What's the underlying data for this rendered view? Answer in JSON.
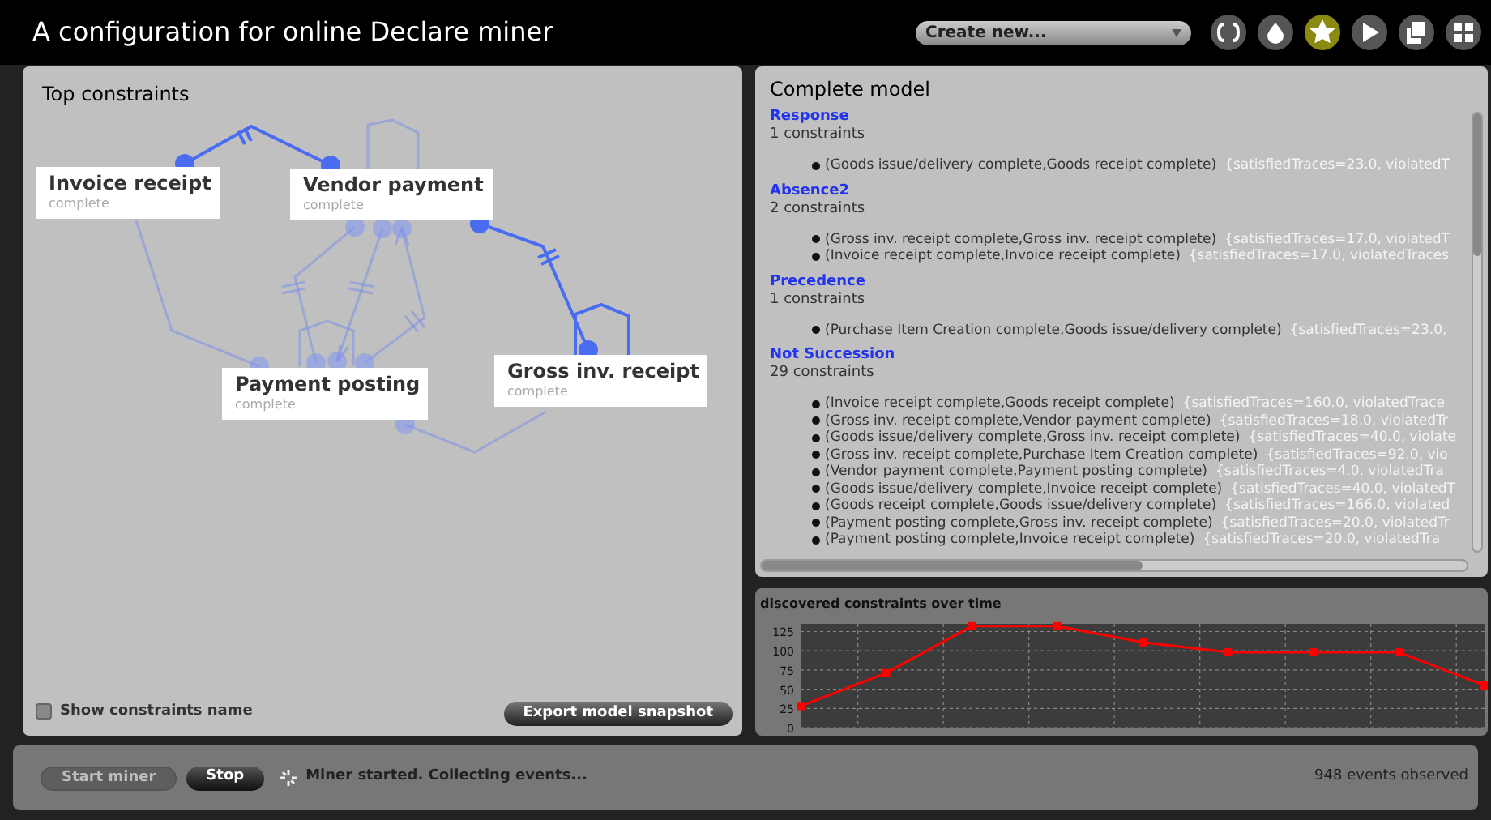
{
  "window": {
    "title": "A configuration for online Declare miner"
  },
  "toolbar": {
    "dropdown": {
      "value": "Create new..."
    },
    "buttons": [
      {
        "kind": "braces",
        "selected": false
      },
      {
        "kind": "drop",
        "selected": false
      },
      {
        "kind": "star",
        "selected": true
      },
      {
        "kind": "play",
        "selected": false
      },
      {
        "kind": "copy",
        "selected": false
      },
      {
        "kind": "grid",
        "selected": false
      }
    ]
  },
  "top_constraints": {
    "title": "Top constraints",
    "nodes": [
      {
        "name": "Invoice receipt",
        "subtitle": "complete"
      },
      {
        "name": "Vendor payment",
        "subtitle": "complete"
      },
      {
        "name": "Payment posting",
        "subtitle": "complete"
      },
      {
        "name": "Gross inv. receipt",
        "subtitle": "complete"
      }
    ],
    "show_names": {
      "label": "Show constraints name",
      "checked": false
    },
    "export_button": "Export model snapshot"
  },
  "complete_model": {
    "title": "Complete model",
    "sections": [
      {
        "name": "Response",
        "count": "1 constraints",
        "constraints": [
          {
            "pair": "(Goods issue/delivery complete,Goods receipt complete)",
            "stats": "{satisfiedTraces=23.0, violatedT"
          }
        ]
      },
      {
        "name": "Absence2",
        "count": "2 constraints",
        "constraints": [
          {
            "pair": "(Gross inv. receipt complete,Gross inv. receipt complete)",
            "stats": "{satisfiedTraces=17.0, violatedT"
          },
          {
            "pair": "(Invoice receipt complete,Invoice receipt complete)",
            "stats": "{satisfiedTraces=17.0, violatedTraces"
          }
        ]
      },
      {
        "name": "Precedence",
        "count": "1 constraints",
        "constraints": [
          {
            "pair": "(Purchase Item Creation complete,Goods issue/delivery complete)",
            "stats": "{satisfiedTraces=23.0,"
          }
        ]
      },
      {
        "name": "Not Succession",
        "count": "29 constraints",
        "constraints": [
          {
            "pair": "(Invoice receipt complete,Goods receipt complete)",
            "stats": "{satisfiedTraces=160.0, violatedTrace"
          },
          {
            "pair": "(Gross inv. receipt complete,Vendor payment complete)",
            "stats": "{satisfiedTraces=18.0, violatedTr"
          },
          {
            "pair": "(Goods issue/delivery complete,Gross inv. receipt complete)",
            "stats": "{satisfiedTraces=40.0, violate"
          },
          {
            "pair": "(Gross inv. receipt complete,Purchase Item Creation complete)",
            "stats": "{satisfiedTraces=92.0, vio"
          },
          {
            "pair": "(Vendor payment complete,Payment posting complete)",
            "stats": "{satisfiedTraces=4.0, violatedTra"
          },
          {
            "pair": "(Goods issue/delivery complete,Invoice receipt complete)",
            "stats": "{satisfiedTraces=40.0, violatedT"
          },
          {
            "pair": "(Goods receipt complete,Goods issue/delivery complete)",
            "stats": "{satisfiedTraces=166.0, violated"
          },
          {
            "pair": "(Payment posting complete,Gross inv. receipt complete)",
            "stats": "{satisfiedTraces=20.0, violatedTr"
          },
          {
            "pair": "(Payment posting complete,Invoice receipt complete)",
            "stats": "{satisfiedTraces=20.0, violatedTra"
          }
        ]
      }
    ]
  },
  "chart_panel": {
    "title": "discovered constraints over time",
    "chart_data": {
      "type": "line",
      "grid": true,
      "ylim": [
        0,
        135
      ],
      "yticks": [
        0,
        25,
        50,
        75,
        100,
        125
      ],
      "series": [
        {
          "color": "#ff0000",
          "marker": "square",
          "values": [
            28,
            71,
            132,
            132,
            111,
            98,
            98,
            98,
            55
          ]
        }
      ]
    }
  },
  "bottom_bar": {
    "start_button": {
      "label": "Start miner",
      "disabled": true
    },
    "stop_button": {
      "label": "Stop",
      "disabled": false
    },
    "status": "Miner started. Collecting events...",
    "events": "948 events observed"
  }
}
